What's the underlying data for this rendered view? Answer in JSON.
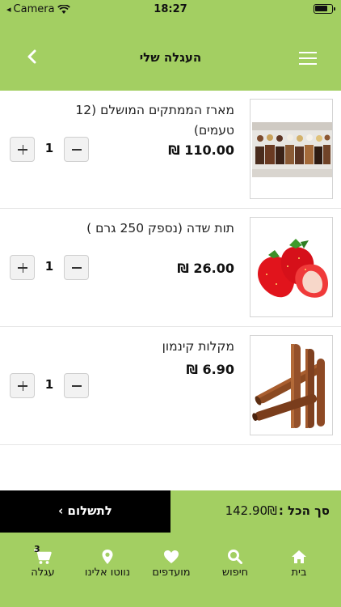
{
  "status_bar": {
    "carrier": "Camera",
    "time": "18:27"
  },
  "header": {
    "title": "העגלה שלי"
  },
  "cart": {
    "items": [
      {
        "name": "מארז הממתקים המושלם (12 טעמים)",
        "price": "110.00 ₪",
        "quantity": "1",
        "image": "chocolate-box"
      },
      {
        "name": "תות שדה (נספק 250 גרם )",
        "price": "26.00 ₪",
        "quantity": "1",
        "image": "strawberries"
      },
      {
        "name": "מקלות קינמון",
        "price": "6.90 ₪",
        "quantity": "1",
        "image": "cinnamon-sticks"
      }
    ]
  },
  "checkout": {
    "pay_label": "לתשלום",
    "total_label": "סך הכל :",
    "total_value": "142.90₪"
  },
  "tabbar": {
    "cart_badge": "3",
    "tabs": [
      {
        "label": "בית",
        "icon": "home-icon"
      },
      {
        "label": "חיפוש",
        "icon": "search-icon"
      },
      {
        "label": "מועדפים",
        "icon": "heart-icon"
      },
      {
        "label": "נווטו אלינו",
        "icon": "location-pin-icon"
      },
      {
        "label": "עגלה",
        "icon": "cart-icon"
      }
    ]
  },
  "colors": {
    "brand": "#a3cf62",
    "pay_button": "#000000"
  }
}
